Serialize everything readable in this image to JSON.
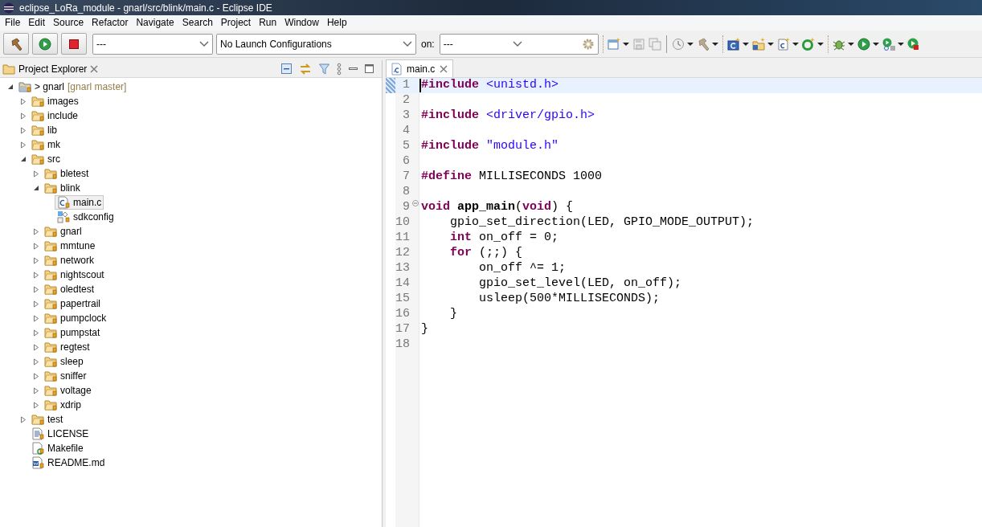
{
  "window": {
    "title": "eclipse_LoRa_module - gnarl/src/blink/main.c - Eclipse IDE"
  },
  "menu": [
    "File",
    "Edit",
    "Source",
    "Refactor",
    "Navigate",
    "Search",
    "Project",
    "Run",
    "Window",
    "Help"
  ],
  "toolbar": {
    "launch_mode": "---",
    "launch_configuration": "No Launch Configurations",
    "target_label": "on:",
    "target": "---"
  },
  "project_explorer": {
    "title": "Project Explorer",
    "tree": [
      {
        "label": "gnarl",
        "decoration": "> ",
        "suffix": "[gnarl master]",
        "kind": "project",
        "expanded": true,
        "selected": false,
        "children": [
          {
            "label": "images",
            "kind": "folder",
            "expanded": false,
            "selected": false
          },
          {
            "label": "include",
            "kind": "folder",
            "expanded": false,
            "selected": false
          },
          {
            "label": "lib",
            "kind": "folder",
            "expanded": false,
            "selected": false
          },
          {
            "label": "mk",
            "kind": "folder",
            "expanded": false,
            "selected": false
          },
          {
            "label": "src",
            "kind": "folder",
            "expanded": true,
            "selected": false,
            "children": [
              {
                "label": "bletest",
                "kind": "folder",
                "expanded": false,
                "selected": false
              },
              {
                "label": "blink",
                "kind": "folder",
                "expanded": true,
                "selected": false,
                "children": [
                  {
                    "label": "main.c",
                    "kind": "c-file",
                    "selected": true
                  },
                  {
                    "label": "sdkconfig",
                    "kind": "config-file",
                    "selected": false
                  }
                ]
              },
              {
                "label": "gnarl",
                "kind": "folder",
                "expanded": false,
                "selected": false
              },
              {
                "label": "mmtune",
                "kind": "folder",
                "expanded": false,
                "selected": false
              },
              {
                "label": "network",
                "kind": "folder",
                "expanded": false,
                "selected": false
              },
              {
                "label": "nightscout",
                "kind": "folder",
                "expanded": false,
                "selected": false
              },
              {
                "label": "oledtest",
                "kind": "folder",
                "expanded": false,
                "selected": false
              },
              {
                "label": "papertrail",
                "kind": "folder",
                "expanded": false,
                "selected": false
              },
              {
                "label": "pumpclock",
                "kind": "folder",
                "expanded": false,
                "selected": false
              },
              {
                "label": "pumpstat",
                "kind": "folder",
                "expanded": false,
                "selected": false
              },
              {
                "label": "regtest",
                "kind": "folder",
                "expanded": false,
                "selected": false
              },
              {
                "label": "sleep",
                "kind": "folder",
                "expanded": false,
                "selected": false
              },
              {
                "label": "sniffer",
                "kind": "folder",
                "expanded": false,
                "selected": false
              },
              {
                "label": "voltage",
                "kind": "folder",
                "expanded": false,
                "selected": false
              },
              {
                "label": "xdrip",
                "kind": "folder",
                "expanded": false,
                "selected": false
              }
            ]
          },
          {
            "label": "test",
            "kind": "folder",
            "expanded": false,
            "selected": false
          },
          {
            "label": "LICENSE",
            "kind": "text-file",
            "selected": false
          },
          {
            "label": "Makefile",
            "kind": "make-file",
            "selected": false
          },
          {
            "label": "README.md",
            "kind": "doc-file",
            "selected": false
          }
        ]
      }
    ]
  },
  "editor": {
    "tabs": [
      {
        "label": "main.c",
        "selected": true
      }
    ],
    "lines": [
      {
        "number": "1",
        "current": true,
        "tokens": [
          {
            "kind": "keyword",
            "text": "#include "
          },
          {
            "kind": "string",
            "text": "<unistd.h>"
          }
        ]
      },
      {
        "number": "2",
        "current": false
      },
      {
        "number": "3",
        "current": false,
        "tokens": [
          {
            "kind": "keyword",
            "text": "#include "
          },
          {
            "kind": "string",
            "text": "<driver/gpio.h>"
          }
        ]
      },
      {
        "number": "4",
        "current": false
      },
      {
        "number": "5",
        "current": false,
        "tokens": [
          {
            "kind": "keyword",
            "text": "#include "
          },
          {
            "kind": "string",
            "text": "\"module.h\""
          }
        ]
      },
      {
        "number": "6",
        "current": false
      },
      {
        "number": "7",
        "current": false,
        "tokens": [
          {
            "kind": "keyword",
            "text": "#define"
          },
          {
            "kind": "plain",
            "text": " MILLISECONDS 1000"
          }
        ]
      },
      {
        "number": "8",
        "current": false
      },
      {
        "number": "9",
        "current": false,
        "foldable": true,
        "tokens": [
          {
            "kind": "keyword",
            "text": "void "
          },
          {
            "kind": "function",
            "text": "app_main"
          },
          {
            "kind": "plain",
            "text": "("
          },
          {
            "kind": "keyword",
            "text": "void"
          },
          {
            "kind": "plain",
            "text": ") {"
          }
        ]
      },
      {
        "number": "10",
        "current": false,
        "tokens": [
          {
            "kind": "plain",
            "text": "    gpio_set_direction(LED, GPIO_MODE_OUTPUT);"
          }
        ]
      },
      {
        "number": "11",
        "current": false,
        "tokens": [
          {
            "kind": "keyword",
            "text": "    int"
          },
          {
            "kind": "plain",
            "text": " on_off = 0;"
          }
        ]
      },
      {
        "number": "12",
        "current": false,
        "tokens": [
          {
            "kind": "keyword",
            "text": "    for"
          },
          {
            "kind": "plain",
            "text": " (;;) {"
          }
        ]
      },
      {
        "number": "13",
        "current": false,
        "tokens": [
          {
            "kind": "plain",
            "text": "        on_off ^= 1;"
          }
        ]
      },
      {
        "number": "14",
        "current": false,
        "tokens": [
          {
            "kind": "plain",
            "text": "        gpio_set_level(LED, on_off);"
          }
        ]
      },
      {
        "number": "15",
        "current": false,
        "tokens": [
          {
            "kind": "plain",
            "text": "        usleep(500*MILLISECONDS);"
          }
        ]
      },
      {
        "number": "16",
        "current": false,
        "tokens": [
          {
            "kind": "plain",
            "text": "    }"
          }
        ]
      },
      {
        "number": "17",
        "current": false,
        "tokens": [
          {
            "kind": "plain",
            "text": "}"
          }
        ]
      },
      {
        "number": "18",
        "current": false
      }
    ]
  }
}
